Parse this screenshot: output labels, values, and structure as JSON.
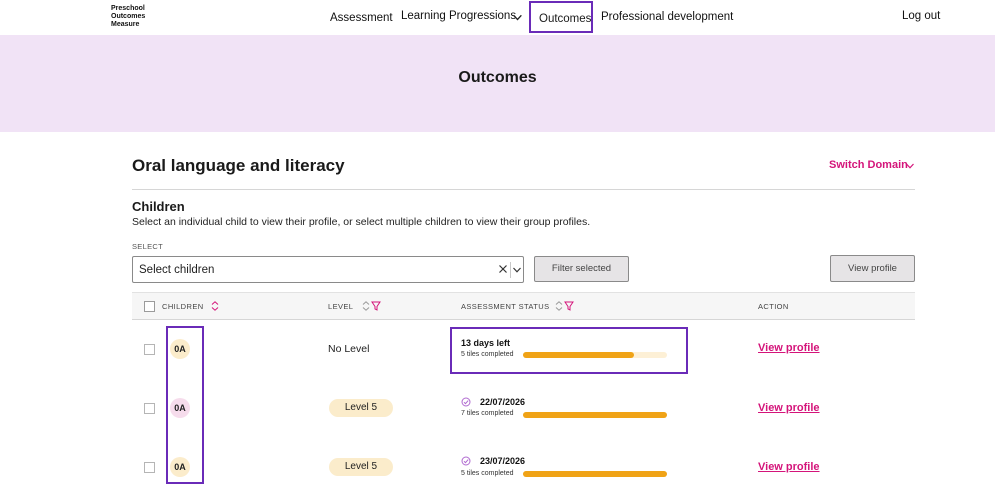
{
  "header": {
    "logo_lines": [
      "Preschool",
      "Outcomes",
      "Measure"
    ],
    "nav": {
      "assessment": "Assessment",
      "learning": "Learning Progressions",
      "outcomes": "Outcomes",
      "professional": "Professional development",
      "logout": "Log out"
    }
  },
  "banner": {
    "title": "Outcomes"
  },
  "domain": {
    "title": "Oral language and literacy",
    "switch_label": "Switch Domain"
  },
  "children_section": {
    "title": "Children",
    "description": "Select an individual child to view their profile, or select multiple children to view their group profiles.",
    "select_label": "SELECT",
    "select_placeholder": "Select children",
    "filter_button": "Filter selected",
    "view_button": "View profile"
  },
  "table": {
    "headers": {
      "children": "CHILDREN",
      "level": "LEVEL",
      "status": "ASSESSMENT STATUS",
      "action": "ACTION"
    },
    "rows": [
      {
        "initials": "0A",
        "avatar_color": "#fbeccb",
        "level": "No Level",
        "level_style": "text",
        "status": "13 days left",
        "status_type": "pending",
        "tiles": "5 tiles completed",
        "progress": 0.77,
        "action": "View profile"
      },
      {
        "initials": "0A",
        "avatar_color": "#f6dcec",
        "level": "Level 5",
        "level_style": "pill",
        "status": "22/07/2026",
        "status_type": "done",
        "tiles": "7 tiles completed",
        "progress": 1.0,
        "action": "View profile"
      },
      {
        "initials": "0A",
        "avatar_color": "#fbeccb",
        "level": "Level 5",
        "level_style": "pill",
        "status": "23/07/2026",
        "status_type": "done",
        "tiles": "5 tiles completed",
        "progress": 1.0,
        "action": "View profile"
      }
    ]
  },
  "colors": {
    "accent_pink": "#d4147a",
    "banner_bg": "#f1e3f6",
    "progress_orange": "#f0a316",
    "highlight_purple": "#6a2bb8"
  }
}
